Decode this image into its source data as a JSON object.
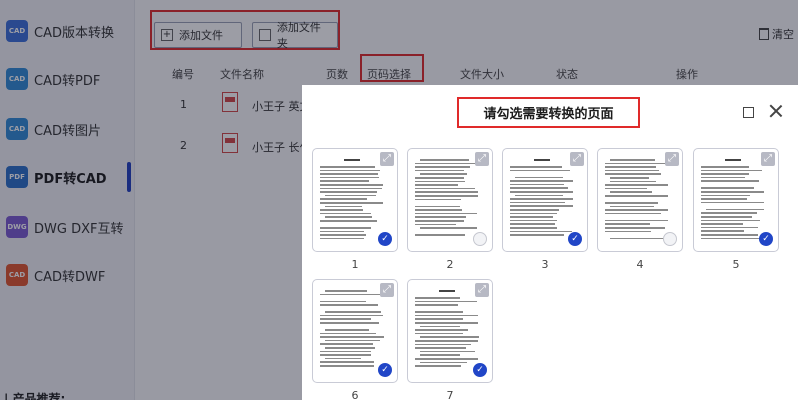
{
  "sidebar": {
    "items": [
      {
        "label": "CAD版本转换",
        "icon": "cad-version-icon",
        "color": "#3b6fd9",
        "badge": "CAD"
      },
      {
        "label": "CAD转PDF",
        "icon": "cad-to-pdf-icon",
        "color": "#2f8bd6",
        "badge": "CAD"
      },
      {
        "label": "CAD转图片",
        "icon": "cad-to-image-icon",
        "color": "#2f8bd6",
        "badge": "CAD"
      },
      {
        "label": "PDF转CAD",
        "icon": "pdf-to-cad-icon",
        "color": "#2a6ec9",
        "badge": "PDF"
      },
      {
        "label": "DWG DXF互转",
        "icon": "dwg-dxf-icon",
        "color": "#7a5ad0",
        "badge": "DWG"
      },
      {
        "label": "CAD转DWF",
        "icon": "cad-to-dwf-icon",
        "color": "#e0552e",
        "badge": "CAD"
      }
    ],
    "active_index": 3,
    "footer_label": "| 产品推荐:"
  },
  "toolbar": {
    "add_file": "添加文件",
    "add_folder": "添加文件夹",
    "clear": "清空"
  },
  "table": {
    "headers": [
      "编号",
      "文件名称",
      "页数",
      "页码选择",
      "文件大小",
      "状态",
      "操作"
    ],
    "rows": [
      {
        "num": "1",
        "name": "小王子 英文"
      },
      {
        "num": "2",
        "name": "小王子 长句"
      }
    ]
  },
  "modal": {
    "title": "请勾选需要转换的页面",
    "pages": [
      {
        "num": "1",
        "checked": true
      },
      {
        "num": "2",
        "checked": false
      },
      {
        "num": "3",
        "checked": true
      },
      {
        "num": "4",
        "checked": false
      },
      {
        "num": "5",
        "checked": true
      },
      {
        "num": "6",
        "checked": true
      },
      {
        "num": "7",
        "checked": true
      }
    ]
  },
  "colors": {
    "highlight_red": "#e02a2a",
    "accent_blue": "#2146c7",
    "active_bar": "#1f3fbf"
  }
}
